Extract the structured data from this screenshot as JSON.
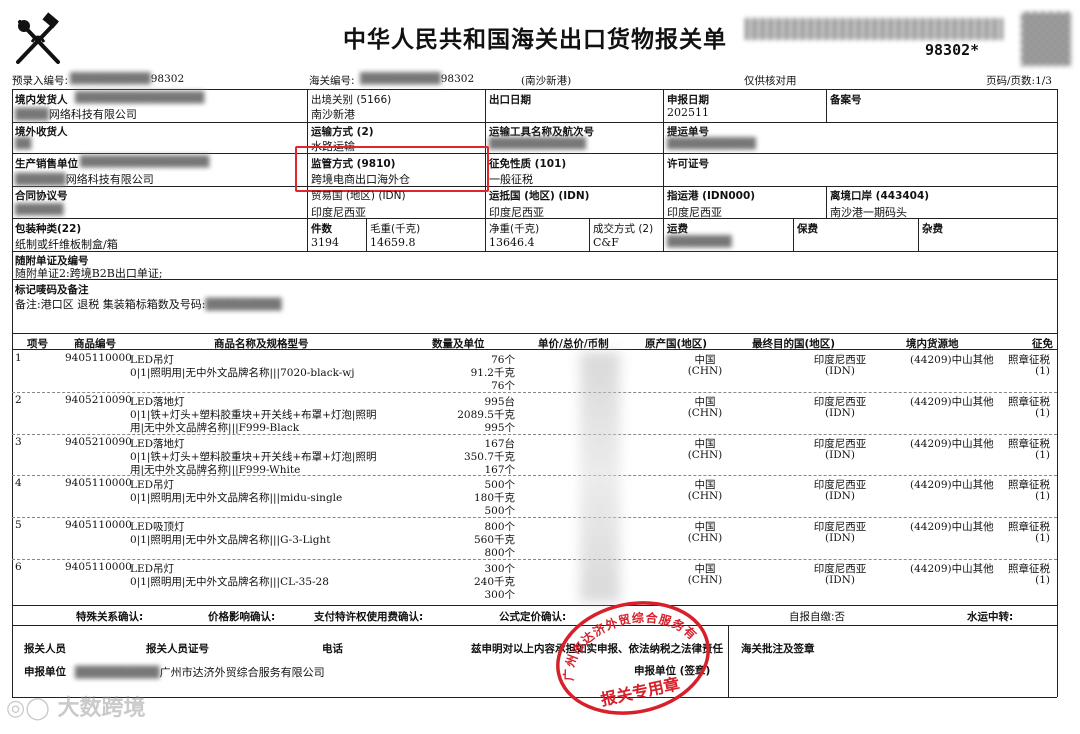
{
  "header": {
    "title": "中华人民共和国海关出口货物报关单",
    "barcode_tail": "98302*",
    "pre_entry_label": "预录入编号:",
    "pre_entry_value": "98302",
    "customs_no_label": "海关编号:",
    "customs_no_value": "98302",
    "port_note": "(南沙新港)",
    "verify_note": "仅供核对用",
    "page_label": "页码/页数:1/3"
  },
  "fields": {
    "domestic_shipper_label": "境内发货人",
    "domestic_shipper_value": "网络科技有限公司",
    "export_port_label": "出境关别 (5166)",
    "export_port_value": "南沙新港",
    "export_date_label": "出口日期",
    "declare_date_label": "申报日期",
    "declare_date_value": "202511",
    "record_no_label": "备案号",
    "overseas_consignee_label": "境外收货人",
    "transport_mode_label": "运输方式 (2)",
    "transport_mode_value": "水路运输",
    "vehicle_label": "运输工具名称及航次号",
    "bill_label": "提运单号",
    "producer_label": "生产销售单位",
    "producer_value": "网络科技有限公司",
    "supervision_label": "监管方式 (9810)",
    "supervision_value": "跨境电商出口海外仓",
    "tax_label": "征免性质 (101)",
    "tax_value": "一般征税",
    "license_label": "许可证号",
    "contract_label": "合同协议号",
    "trade_country_label": "贸易国 (地区) (IDN)",
    "trade_country_value": "印度尼西亚",
    "dest_country_label": "运抵国 (地区) (IDN)",
    "dest_country_value": "印度尼西亚",
    "dest_port_label": "指运港 (IDN000)",
    "dest_port_value": "印度尼西亚",
    "exit_port_label": "离境口岸 (443404)",
    "exit_port_value": "南沙港一期码头",
    "package_label": "包装种类(22)",
    "package_value": "纸制或纤维板制盒/箱",
    "pieces_label": "件数",
    "pieces_value": "3194",
    "gross_label": "毛重(千克)",
    "gross_value": "14659.8",
    "net_label": "净重(千克)",
    "net_value": "13646.4",
    "deal_label": "成交方式 (2)",
    "deal_value": "C&F",
    "freight_label": "运费",
    "insurance_label": "保费",
    "misc_label": "杂费",
    "attached_label": "随附单证及编号",
    "attached_value": "随附单证2:跨境B2B出口单证;",
    "marks_label": "标记唛码及备注",
    "marks_value": "备注:港口区 退税 集装箱标箱数及号码:"
  },
  "goods_header": {
    "no": "项号",
    "code": "商品编号",
    "name": "商品名称及规格型号",
    "qty": "数量及单位",
    "price": "单价/总价/币制",
    "origin": "原产国(地区)",
    "final_dest": "最终目的国(地区)",
    "source": "境内货源地",
    "tax": "征免"
  },
  "goods": [
    {
      "no": "1",
      "code": "9405110000",
      "name1": "LED吊灯",
      "name2": "0|1|照明用|无中外文品牌名称|||7020-black-wj",
      "name3": "",
      "qty": [
        "76个",
        "91.2千克",
        "76个"
      ],
      "origin": [
        "中国",
        "(CHN)"
      ],
      "dest": [
        "印度尼西亚",
        "(IDN)"
      ],
      "source": "(44209)中山其他",
      "tax": [
        "照章征税",
        "(1)"
      ]
    },
    {
      "no": "2",
      "code": "9405210090",
      "name1": "LED落地灯",
      "name2": "0|1|铁+灯头+塑料胶重块+开关线+布罩+灯泡|照明",
      "name3": "用|无中外文品牌名称|||F999-Black",
      "qty": [
        "995台",
        "2089.5千克",
        "995个"
      ],
      "origin": [
        "中国",
        "(CHN)"
      ],
      "dest": [
        "印度尼西亚",
        "(IDN)"
      ],
      "source": "(44209)中山其他",
      "tax": [
        "照章征税",
        "(1)"
      ]
    },
    {
      "no": "3",
      "code": "9405210090",
      "name1": "LED落地灯",
      "name2": "0|1|铁+灯头+塑料胶重块+开关线+布罩+灯泡|照明",
      "name3": "用|无中外文品牌名称|||F999-White",
      "qty": [
        "167台",
        "350.7千克",
        "167个"
      ],
      "origin": [
        "中国",
        "(CHN)"
      ],
      "dest": [
        "印度尼西亚",
        "(IDN)"
      ],
      "source": "(44209)中山其他",
      "tax": [
        "照章征税",
        "(1)"
      ]
    },
    {
      "no": "4",
      "code": "9405110000",
      "name1": "LED吊灯",
      "name2": "0|1|照明用|无中外文品牌名称|||midu-single",
      "name3": "",
      "qty": [
        "500个",
        "180千克",
        "500个"
      ],
      "origin": [
        "中国",
        "(CHN)"
      ],
      "dest": [
        "印度尼西亚",
        "(IDN)"
      ],
      "source": "(44209)中山其他",
      "tax": [
        "照章征税",
        "(1)"
      ]
    },
    {
      "no": "5",
      "code": "9405110000",
      "name1": "LED吸顶灯",
      "name2": "0|1|照明用|无中外文品牌名称|||G-3-Light",
      "name3": "",
      "qty": [
        "800个",
        "560千克",
        "800个"
      ],
      "origin": [
        "中国",
        "(CHN)"
      ],
      "dest": [
        "印度尼西亚",
        "(IDN)"
      ],
      "source": "(44209)中山其他",
      "tax": [
        "照章征税",
        "(1)"
      ]
    },
    {
      "no": "6",
      "code": "9405110000",
      "name1": "LED吊灯",
      "name2": "0|1|照明用|无中外文品牌名称|||CL-35-28",
      "name3": "",
      "qty": [
        "300个",
        "240千克",
        "300个"
      ],
      "origin": [
        "中国",
        "(CHN)"
      ],
      "dest": [
        "印度尼西亚",
        "(IDN)"
      ],
      "source": "(44209)中山其他",
      "tax": [
        "照章征税",
        "(1)"
      ]
    }
  ],
  "confirm": {
    "special": "特殊关系确认:",
    "price": "价格影响确认:",
    "royalty": "支付特许权使用费确认:",
    "formula": "公式定价确认:",
    "self_label": "自报自缴:否",
    "transit": "水运中转:"
  },
  "footer": {
    "declarant": "报关人员",
    "declarant_cert": "报关人员证号",
    "phone": "电话",
    "statement": "兹申明对以上内容承担如实申报、依法纳税之法律责任",
    "customs_note": "海关批注及签章",
    "unit_label": "申报单位",
    "unit_value": "广州市达济外贸综合服务有限公司",
    "unit_sign": "申报单位 (签章)",
    "stamp_outer": "广州市达济外贸综合服务有限公司",
    "stamp_inner": "报关专用章",
    "watermark": "大数跨境"
  }
}
